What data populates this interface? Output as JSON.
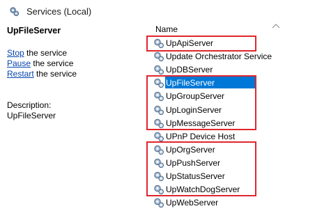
{
  "window": {
    "title": "Services (Local)"
  },
  "details": {
    "service_name": "UpFileServer",
    "actions": [
      {
        "link": "Stop",
        "rest": " the service"
      },
      {
        "link": "Pause",
        "rest": " the service"
      },
      {
        "link": "Restart",
        "rest": " the service"
      }
    ],
    "description_label": "Description:",
    "description_value": "UpFileServer"
  },
  "list": {
    "column_name": "Name",
    "selected": "UpFileServer",
    "services": [
      "UpApiServer",
      "Update Orchestrator Service",
      "UpDBServer",
      "UpFileServer",
      "UpGroupServer",
      "UpLoginServer",
      "UpMessageServer",
      "UPnP Device Host",
      "UpOrgServer",
      "UpPushServer",
      "UpStatusServer",
      "UpWatchDogServer",
      "UpWebServer"
    ]
  },
  "colors": {
    "highlight_box": "#e0262e",
    "selection": "#0078d7",
    "link": "#0645ad"
  },
  "icons": {
    "title": "services-gear-icon",
    "service": "service-gear-icon",
    "sort": "chevron-up-icon"
  }
}
